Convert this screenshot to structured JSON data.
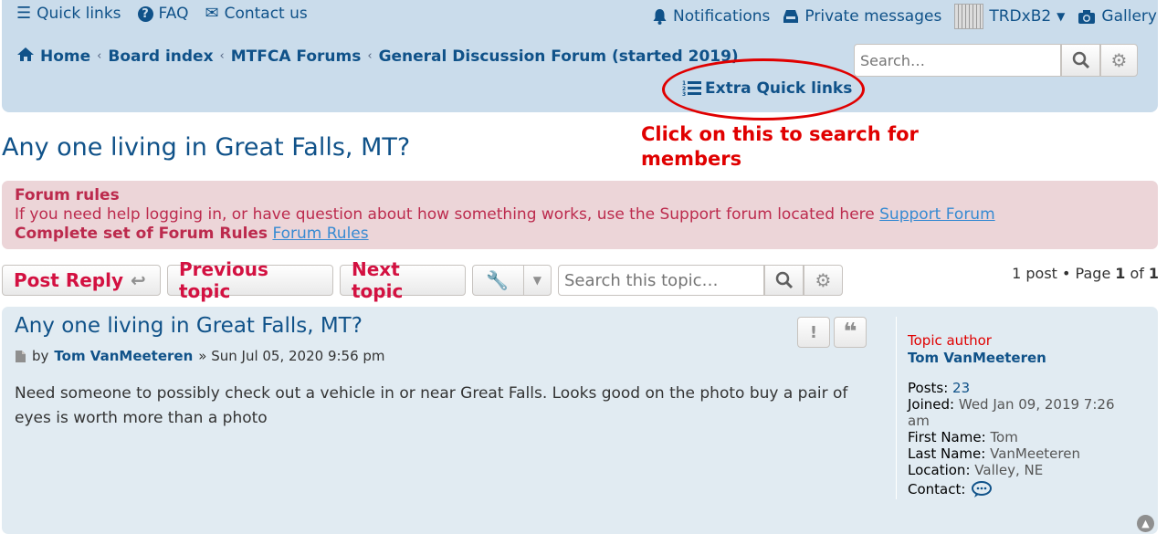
{
  "topnav": {
    "quick_links": "Quick links",
    "faq": "FAQ",
    "contact": "Contact us",
    "notifications": "Notifications",
    "private_messages": "Private messages",
    "username": "TRDxB2",
    "gallery": "Gallery"
  },
  "breadcrumb": {
    "home": "Home",
    "board_index": "Board index",
    "forums": "MTFCA Forums",
    "forum": "General Discussion Forum (started 2019)"
  },
  "search": {
    "placeholder": "Search…"
  },
  "extra_quick_links": "Extra Quick links",
  "annotation": {
    "line1": "Click on this to search for",
    "line2": "members"
  },
  "topic_title": "Any one living in Great Falls, MT?",
  "rules": {
    "heading": "Forum rules",
    "text": "If you need help logging in, or have question about how something works, use the Support forum located here",
    "support_link": "Support Forum",
    "complete_label": "Complete set of Forum Rules",
    "rules_link": "Forum Rules"
  },
  "actions": {
    "post_reply": "Post Reply",
    "previous_topic": "Previous topic",
    "next_topic": "Next topic",
    "search_placeholder": "Search this topic…"
  },
  "pagination": {
    "count": "1 post • Page",
    "page": "1",
    "of": "of",
    "total": "1"
  },
  "post": {
    "title": "Any one living in Great Falls, MT?",
    "by": "by",
    "author": "Tom VanMeeteren",
    "date": "» Sun Jul 05, 2020 9:56 pm",
    "body_line1": "Need someone to possibly check out a vehicle in or near Great Falls. Looks good on the photo buy a pair of",
    "body_line2": "eyes is worth more than a photo"
  },
  "profile": {
    "role": "Topic author",
    "name": "Tom VanMeeteren",
    "posts_label": "Posts:",
    "posts_value": "23",
    "joined_label": "Joined:",
    "joined_value": "Wed Jan 09, 2019 7:26",
    "joined_value2": "am",
    "first_name_label": "First Name:",
    "first_name_value": "Tom",
    "last_name_label": "Last Name:",
    "last_name_value": "VanMeeteren",
    "location_label": "Location:",
    "location_value": "Valley, NE",
    "contact_label": "Contact:"
  },
  "colors": {
    "header_bg": "#cadceb",
    "link": "#105289",
    "accent_red": "#d31141",
    "annotation_red": "#e00000",
    "rules_bg": "#ecd5d8",
    "post_bg": "#e1ebf2"
  }
}
